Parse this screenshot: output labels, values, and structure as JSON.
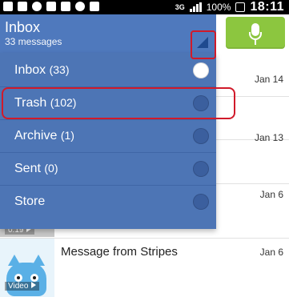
{
  "status_bar": {
    "left_icons": [
      "notification-icon-1",
      "notification-icon-2",
      "notification-icon-3",
      "notification-icon-4",
      "notification-icon-5",
      "notification-icon-6",
      "notification-icon-7"
    ],
    "network": "3G",
    "battery": "100%",
    "time": "18:11"
  },
  "header": {
    "title": "Inbox",
    "subtitle": "33 messages",
    "dropdown_icon": "triangle-dropdown-icon",
    "mic_icon": "microphone-icon",
    "mic_color": "#8cc63f",
    "bar_color": "#4f79bd"
  },
  "dropdown": {
    "items": [
      {
        "label": "Inbox",
        "count": "(33)",
        "selected": true
      },
      {
        "label": "Trash",
        "count": "(102)",
        "selected": false
      },
      {
        "label": "Archive",
        "count": "(1)",
        "selected": false
      },
      {
        "label": "Sent",
        "count": "(0)",
        "selected": false
      },
      {
        "label": "Store",
        "count": "",
        "selected": false
      }
    ]
  },
  "messages": {
    "dates": [
      "Jan 14",
      "Jan 13",
      "Jan 6",
      "Jan 6"
    ],
    "thumb_time": "0:19",
    "video_label": "Video",
    "stripes_title": "Message from Stripes"
  },
  "annotation_color": "#d11a2a"
}
